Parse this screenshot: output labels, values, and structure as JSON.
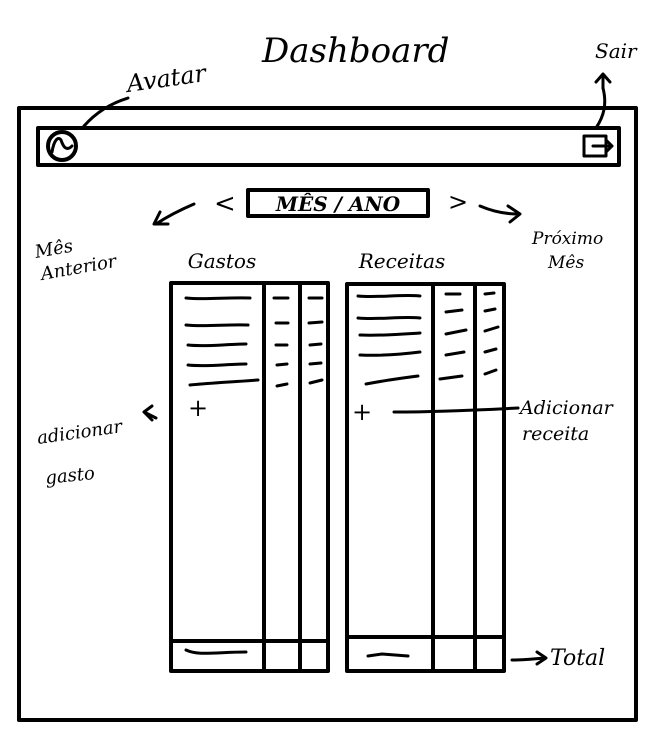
{
  "title": "Dashboard",
  "annotations": {
    "avatar": "Avatar",
    "sair": "Sair",
    "mes_anterior": [
      "Mês",
      "Anterior"
    ],
    "proximo_mes": [
      "Próximo",
      "Mês"
    ],
    "adicionar_gasto": [
      "adicionar",
      "gasto"
    ],
    "adicionar_receita": [
      "Adicionar",
      "receita"
    ],
    "total": "Total"
  },
  "month_selector": {
    "label": "MÊS / ANO",
    "prev": "<",
    "next": ">"
  },
  "columns": {
    "gastos": {
      "header": "Gastos",
      "add": "+"
    },
    "receitas": {
      "header": "Receitas",
      "add": "+"
    }
  },
  "icons": {
    "avatar": "avatar-icon",
    "logout": "logout-icon"
  }
}
